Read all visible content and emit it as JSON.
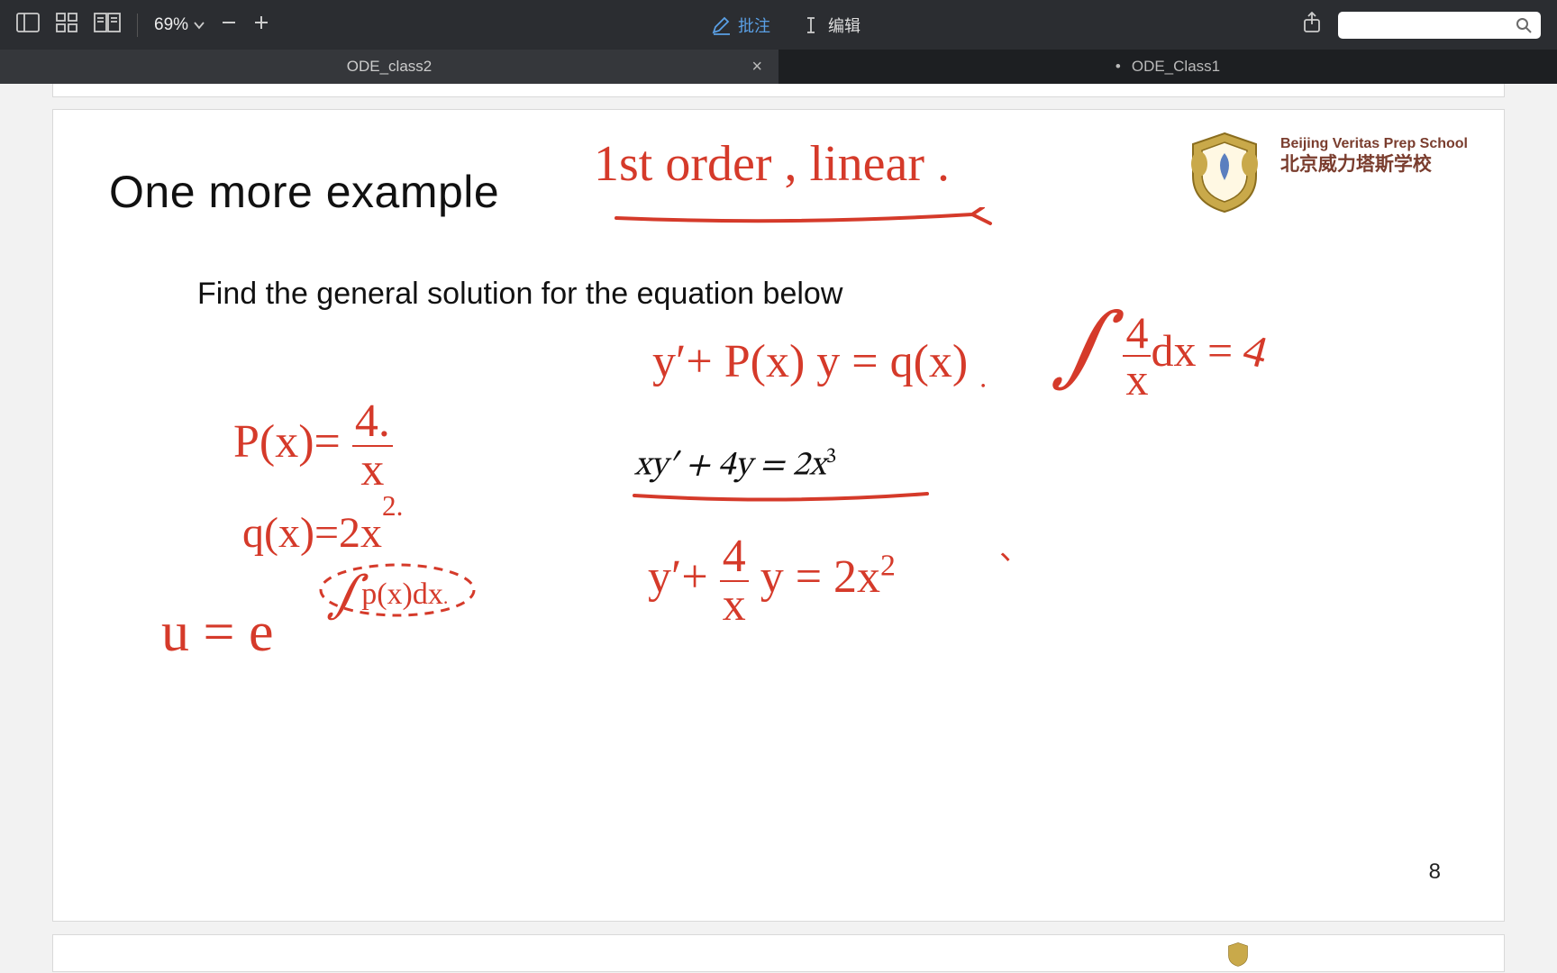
{
  "toolbar": {
    "zoom_label": "69%",
    "annotate_label": "批注",
    "edit_label": "编辑",
    "search_placeholder": ""
  },
  "tabs": {
    "left": "ODE_class2",
    "right_prefix": "•",
    "right": "ODE_Class1"
  },
  "slide": {
    "title": "One more example",
    "subtitle": "Find the general solution for the equation below",
    "equation_html": "xy′ + 4y = 2x³",
    "page_number": "8",
    "org_en": "Beijing Veritas Prep School",
    "org_cn": "北京威力塔斯学校"
  },
  "handwriting": {
    "header": "1st order , linear .",
    "standard_form": "y′ + P(x) y = q(x) .",
    "divided_form": "y′ + (4/x) y = 2x²",
    "p_def": "P(x) = 4/x",
    "q_def": "q(x) = 2x²",
    "u_def": "u = e^{∫ p(x) dx}",
    "integral": "∫ (4/x) dx = 4"
  }
}
